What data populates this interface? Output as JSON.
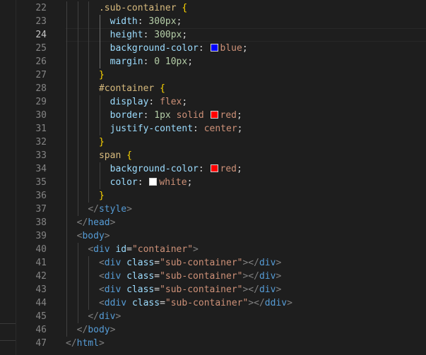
{
  "editor": {
    "language": "html",
    "active_line": 24,
    "lines": [
      {
        "n": 22,
        "tokens": [
          {
            "t": ".sub-container",
            "c": "sel"
          },
          {
            "t": " ",
            "c": "punc"
          },
          {
            "t": "{",
            "c": "brace"
          }
        ]
      },
      {
        "n": 23,
        "tokens": [
          {
            "t": "width",
            "c": "prop"
          },
          {
            "t": ": ",
            "c": "punc"
          },
          {
            "t": "300px",
            "c": "num"
          },
          {
            "t": ";",
            "c": "punc"
          }
        ]
      },
      {
        "n": 24,
        "tokens": [
          {
            "t": "height",
            "c": "prop"
          },
          {
            "t": ": ",
            "c": "punc"
          },
          {
            "t": "300px",
            "c": "num"
          },
          {
            "t": ";",
            "c": "punc"
          }
        ]
      },
      {
        "n": 25,
        "tokens": [
          {
            "t": "background-color",
            "c": "prop"
          },
          {
            "t": ": ",
            "c": "punc"
          },
          {
            "swatch": "#0000ff"
          },
          {
            "t": "blue",
            "c": "val"
          },
          {
            "t": ";",
            "c": "punc"
          }
        ]
      },
      {
        "n": 26,
        "tokens": [
          {
            "t": "margin",
            "c": "prop"
          },
          {
            "t": ": ",
            "c": "punc"
          },
          {
            "t": "0",
            "c": "num"
          },
          {
            "t": " ",
            "c": "punc"
          },
          {
            "t": "10px",
            "c": "num"
          },
          {
            "t": ";",
            "c": "punc"
          }
        ]
      },
      {
        "n": 27,
        "tokens": [
          {
            "t": "}",
            "c": "brace"
          }
        ]
      },
      {
        "n": 28,
        "tokens": [
          {
            "t": "#container",
            "c": "sel"
          },
          {
            "t": " ",
            "c": "punc"
          },
          {
            "t": "{",
            "c": "brace"
          }
        ]
      },
      {
        "n": 29,
        "tokens": [
          {
            "t": "display",
            "c": "prop"
          },
          {
            "t": ": ",
            "c": "punc"
          },
          {
            "t": "flex",
            "c": "val"
          },
          {
            "t": ";",
            "c": "punc"
          }
        ]
      },
      {
        "n": 30,
        "tokens": [
          {
            "t": "border",
            "c": "prop"
          },
          {
            "t": ": ",
            "c": "punc"
          },
          {
            "t": "1px",
            "c": "num"
          },
          {
            "t": " ",
            "c": "punc"
          },
          {
            "t": "solid",
            "c": "val"
          },
          {
            "t": " ",
            "c": "punc"
          },
          {
            "swatch": "#ff0000"
          },
          {
            "t": "red",
            "c": "val"
          },
          {
            "t": ";",
            "c": "punc"
          }
        ]
      },
      {
        "n": 31,
        "tokens": [
          {
            "t": "justify-content",
            "c": "prop"
          },
          {
            "t": ": ",
            "c": "punc"
          },
          {
            "t": "center",
            "c": "val"
          },
          {
            "t": ";",
            "c": "punc"
          }
        ]
      },
      {
        "n": 32,
        "tokens": [
          {
            "t": "}",
            "c": "brace"
          }
        ]
      },
      {
        "n": 33,
        "tokens": [
          {
            "t": "span",
            "c": "sel"
          },
          {
            "t": " ",
            "c": "punc"
          },
          {
            "t": "{",
            "c": "brace"
          }
        ]
      },
      {
        "n": 34,
        "tokens": [
          {
            "t": "background-color",
            "c": "prop"
          },
          {
            "t": ": ",
            "c": "punc"
          },
          {
            "swatch": "#ff0000"
          },
          {
            "t": "red",
            "c": "val"
          },
          {
            "t": ";",
            "c": "punc"
          }
        ]
      },
      {
        "n": 35,
        "tokens": [
          {
            "t": "color",
            "c": "prop"
          },
          {
            "t": ": ",
            "c": "punc"
          },
          {
            "swatch": "#ffffff"
          },
          {
            "t": "white",
            "c": "val"
          },
          {
            "t": ";",
            "c": "punc"
          }
        ]
      },
      {
        "n": 36,
        "tokens": [
          {
            "t": "}",
            "c": "brace"
          }
        ]
      },
      {
        "n": 37,
        "tokens": [
          {
            "t": "</",
            "c": "br"
          },
          {
            "t": "style",
            "c": "tag"
          },
          {
            "t": ">",
            "c": "br"
          }
        ]
      },
      {
        "n": 38,
        "tokens": [
          {
            "t": "</",
            "c": "br"
          },
          {
            "t": "head",
            "c": "tag"
          },
          {
            "t": ">",
            "c": "br"
          }
        ]
      },
      {
        "n": 39,
        "tokens": [
          {
            "t": "<",
            "c": "br"
          },
          {
            "t": "body",
            "c": "tag"
          },
          {
            "t": ">",
            "c": "br"
          }
        ]
      },
      {
        "n": 40,
        "tokens": [
          {
            "t": "<",
            "c": "br"
          },
          {
            "t": "div",
            "c": "tag"
          },
          {
            "t": " ",
            "c": "punc"
          },
          {
            "t": "id",
            "c": "attr"
          },
          {
            "t": "=",
            "c": "punc"
          },
          {
            "t": "\"container\"",
            "c": "str"
          },
          {
            "t": ">",
            "c": "br"
          }
        ]
      },
      {
        "n": 41,
        "tokens": [
          {
            "t": "<",
            "c": "br"
          },
          {
            "t": "div",
            "c": "tag"
          },
          {
            "t": " ",
            "c": "punc"
          },
          {
            "t": "class",
            "c": "attr"
          },
          {
            "t": "=",
            "c": "punc"
          },
          {
            "t": "\"sub-container\"",
            "c": "str"
          },
          {
            "t": "></",
            "c": "br"
          },
          {
            "t": "div",
            "c": "tag"
          },
          {
            "t": ">",
            "c": "br"
          }
        ]
      },
      {
        "n": 42,
        "tokens": [
          {
            "t": "<",
            "c": "br"
          },
          {
            "t": "div",
            "c": "tag"
          },
          {
            "t": " ",
            "c": "punc"
          },
          {
            "t": "class",
            "c": "attr"
          },
          {
            "t": "=",
            "c": "punc"
          },
          {
            "t": "\"sub-container\"",
            "c": "str"
          },
          {
            "t": "></",
            "c": "br"
          },
          {
            "t": "div",
            "c": "tag"
          },
          {
            "t": ">",
            "c": "br"
          }
        ]
      },
      {
        "n": 43,
        "tokens": [
          {
            "t": "<",
            "c": "br"
          },
          {
            "t": "div",
            "c": "tag"
          },
          {
            "t": " ",
            "c": "punc"
          },
          {
            "t": "class",
            "c": "attr"
          },
          {
            "t": "=",
            "c": "punc"
          },
          {
            "t": "\"sub-container\"",
            "c": "str"
          },
          {
            "t": "></",
            "c": "br"
          },
          {
            "t": "div",
            "c": "tag"
          },
          {
            "t": ">",
            "c": "br"
          }
        ]
      },
      {
        "n": 44,
        "tokens": [
          {
            "t": "<",
            "c": "br"
          },
          {
            "t": "ddiv",
            "c": "tag"
          },
          {
            "t": " ",
            "c": "punc"
          },
          {
            "t": "class",
            "c": "attr"
          },
          {
            "t": "=",
            "c": "punc"
          },
          {
            "t": "\"sub-container\"",
            "c": "str"
          },
          {
            "t": "></",
            "c": "br"
          },
          {
            "t": "ddiv",
            "c": "tag"
          },
          {
            "t": ">",
            "c": "br"
          }
        ]
      },
      {
        "n": 45,
        "tokens": [
          {
            "t": "</",
            "c": "br"
          },
          {
            "t": "div",
            "c": "tag"
          },
          {
            "t": ">",
            "c": "br"
          }
        ]
      },
      {
        "n": 46,
        "tokens": [
          {
            "t": "</",
            "c": "br"
          },
          {
            "t": "body",
            "c": "tag"
          },
          {
            "t": ">",
            "c": "br"
          }
        ]
      },
      {
        "n": 47,
        "tokens": [
          {
            "t": "</",
            "c": "br"
          },
          {
            "t": "html",
            "c": "tag"
          },
          {
            "t": ">",
            "c": "br"
          }
        ]
      }
    ]
  },
  "colors": {
    "background": "#1e1e1e",
    "line_number": "#858585",
    "line_number_active": "#c6c6c6"
  }
}
